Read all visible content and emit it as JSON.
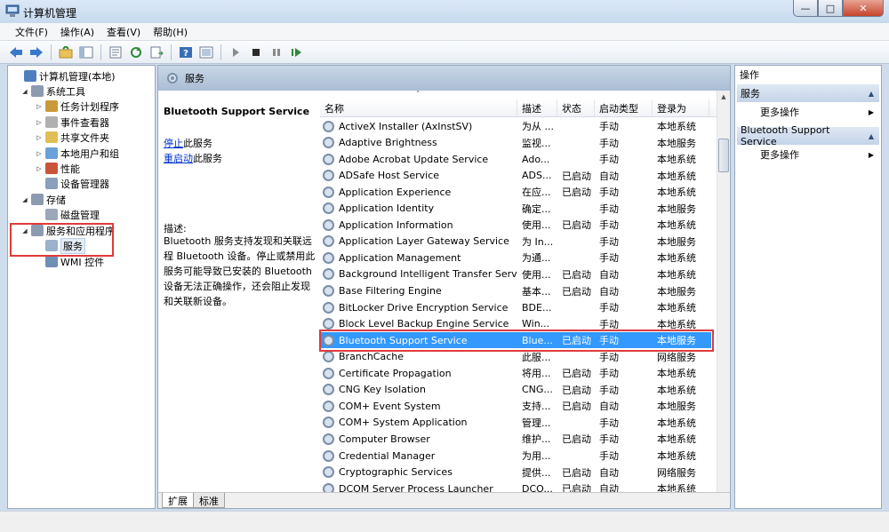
{
  "window": {
    "title": "计算机管理",
    "min": "—",
    "max": "□",
    "close": "✕"
  },
  "menu": [
    "文件(F)",
    "操作(A)",
    "查看(V)",
    "帮助(H)"
  ],
  "tree": [
    {
      "label": "计算机管理(本地)",
      "level": 0,
      "expander": "",
      "icon": "computer-icon"
    },
    {
      "label": "系统工具",
      "level": 1,
      "expander": "◢",
      "icon": "tools-icon"
    },
    {
      "label": "任务计划程序",
      "level": 2,
      "expander": "▷",
      "icon": "clock-icon"
    },
    {
      "label": "事件查看器",
      "level": 2,
      "expander": "▷",
      "icon": "event-viewer-icon"
    },
    {
      "label": "共享文件夹",
      "level": 2,
      "expander": "▷",
      "icon": "shared-folder-icon"
    },
    {
      "label": "本地用户和组",
      "level": 2,
      "expander": "▷",
      "icon": "users-icon"
    },
    {
      "label": "性能",
      "level": 2,
      "expander": "▷",
      "icon": "performance-icon"
    },
    {
      "label": "设备管理器",
      "level": 2,
      "expander": "",
      "icon": "device-manager-icon"
    },
    {
      "label": "存储",
      "level": 1,
      "expander": "◢",
      "icon": "storage-icon"
    },
    {
      "label": "磁盘管理",
      "level": 2,
      "expander": "",
      "icon": "disk-icon"
    },
    {
      "label": "服务和应用程序",
      "level": 1,
      "expander": "◢",
      "icon": "services-apps-icon"
    },
    {
      "label": "服务",
      "level": 2,
      "expander": "",
      "icon": "services-icon"
    },
    {
      "label": "WMI 控件",
      "level": 2,
      "expander": "",
      "icon": "wmi-icon"
    }
  ],
  "center": {
    "header": "服务",
    "selected_service": "Bluetooth Support Service",
    "stop_link": "停止",
    "stop_text": "此服务",
    "restart_link": "重启动",
    "restart_text": "此服务",
    "desc_label": "描述:",
    "desc_text": "Bluetooth 服务支持发现和关联远程 Bluetooth 设备。停止或禁用此服务可能导致已安装的 Bluetooth 设备无法正确操作，还会阻止发现和关联新设备。"
  },
  "list": {
    "sort_indicator": "˄",
    "columns": [
      "名称",
      "描述",
      "状态",
      "启动类型",
      "登录为"
    ],
    "rows": [
      [
        "ActiveX Installer (AxInstSV)",
        "为从 ...",
        "",
        "手动",
        "本地系统"
      ],
      [
        "Adaptive Brightness",
        "监视...",
        "",
        "手动",
        "本地服务"
      ],
      [
        "Adobe Acrobat Update Service",
        "Ado...",
        "",
        "手动",
        "本地系统"
      ],
      [
        "ADSafe Host Service",
        "ADS...",
        "已启动",
        "自动",
        "本地系统"
      ],
      [
        "Application Experience",
        "在应...",
        "已启动",
        "手动",
        "本地系统"
      ],
      [
        "Application Identity",
        "确定...",
        "",
        "手动",
        "本地服务"
      ],
      [
        "Application Information",
        "使用...",
        "已启动",
        "手动",
        "本地系统"
      ],
      [
        "Application Layer Gateway Service",
        "为 In...",
        "",
        "手动",
        "本地服务"
      ],
      [
        "Application Management",
        "为通...",
        "",
        "手动",
        "本地系统"
      ],
      [
        "Background Intelligent Transfer Serv...",
        "使用...",
        "已启动",
        "自动",
        "本地系统"
      ],
      [
        "Base Filtering Engine",
        "基本...",
        "已启动",
        "自动",
        "本地服务"
      ],
      [
        "BitLocker Drive Encryption Service",
        "BDE...",
        "",
        "手动",
        "本地系统"
      ],
      [
        "Block Level Backup Engine Service",
        "Win...",
        "",
        "手动",
        "本地系统"
      ],
      [
        "Bluetooth Support Service",
        "Blue...",
        "已启动",
        "手动",
        "本地服务"
      ],
      [
        "BranchCache",
        "此服...",
        "",
        "手动",
        "网络服务"
      ],
      [
        "Certificate Propagation",
        "将用...",
        "已启动",
        "手动",
        "本地系统"
      ],
      [
        "CNG Key Isolation",
        "CNG...",
        "已启动",
        "手动",
        "本地系统"
      ],
      [
        "COM+ Event System",
        "支持...",
        "已启动",
        "自动",
        "本地服务"
      ],
      [
        "COM+ System Application",
        "管理...",
        "",
        "手动",
        "本地系统"
      ],
      [
        "Computer Browser",
        "维护...",
        "已启动",
        "手动",
        "本地系统"
      ],
      [
        "Credential Manager",
        "为用...",
        "",
        "手动",
        "本地系统"
      ],
      [
        "Cryptographic Services",
        "提供...",
        "已启动",
        "自动",
        "网络服务"
      ],
      [
        "DCOM Server Process Launcher",
        "DCO...",
        "已启动",
        "自动",
        "本地系统"
      ]
    ]
  },
  "tabs": [
    "扩展",
    "标准"
  ],
  "actions": {
    "title": "操作",
    "section1": "服务",
    "more1": "更多操作",
    "section2": "Bluetooth Support Service",
    "more2": "更多操作",
    "collapse": "▲",
    "arrow": "▶"
  }
}
